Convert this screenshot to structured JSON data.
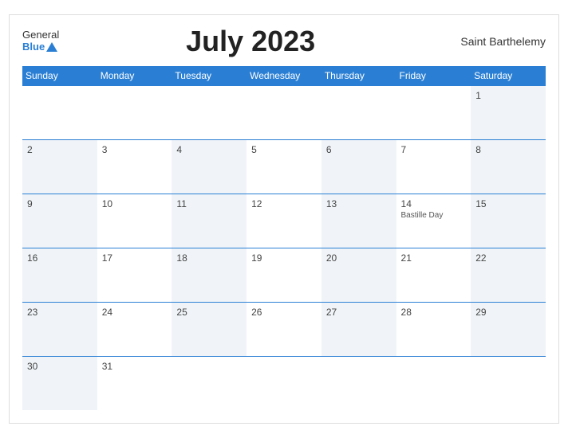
{
  "header": {
    "logo_general": "General",
    "logo_blue": "Blue",
    "title": "July 2023",
    "country": "Saint Barthelemy"
  },
  "weekdays": [
    "Sunday",
    "Monday",
    "Tuesday",
    "Wednesday",
    "Thursday",
    "Friday",
    "Saturday"
  ],
  "weeks": [
    [
      {
        "day": "",
        "holiday": ""
      },
      {
        "day": "",
        "holiday": ""
      },
      {
        "day": "",
        "holiday": ""
      },
      {
        "day": "",
        "holiday": ""
      },
      {
        "day": "",
        "holiday": ""
      },
      {
        "day": "",
        "holiday": ""
      },
      {
        "day": "1",
        "holiday": ""
      }
    ],
    [
      {
        "day": "2",
        "holiday": ""
      },
      {
        "day": "3",
        "holiday": ""
      },
      {
        "day": "4",
        "holiday": ""
      },
      {
        "day": "5",
        "holiday": ""
      },
      {
        "day": "6",
        "holiday": ""
      },
      {
        "day": "7",
        "holiday": ""
      },
      {
        "day": "8",
        "holiday": ""
      }
    ],
    [
      {
        "day": "9",
        "holiday": ""
      },
      {
        "day": "10",
        "holiday": ""
      },
      {
        "day": "11",
        "holiday": ""
      },
      {
        "day": "12",
        "holiday": ""
      },
      {
        "day": "13",
        "holiday": ""
      },
      {
        "day": "14",
        "holiday": "Bastille Day"
      },
      {
        "day": "15",
        "holiday": ""
      }
    ],
    [
      {
        "day": "16",
        "holiday": ""
      },
      {
        "day": "17",
        "holiday": ""
      },
      {
        "day": "18",
        "holiday": ""
      },
      {
        "day": "19",
        "holiday": ""
      },
      {
        "day": "20",
        "holiday": ""
      },
      {
        "day": "21",
        "holiday": ""
      },
      {
        "day": "22",
        "holiday": ""
      }
    ],
    [
      {
        "day": "23",
        "holiday": ""
      },
      {
        "day": "24",
        "holiday": ""
      },
      {
        "day": "25",
        "holiday": ""
      },
      {
        "day": "26",
        "holiday": ""
      },
      {
        "day": "27",
        "holiday": ""
      },
      {
        "day": "28",
        "holiday": ""
      },
      {
        "day": "29",
        "holiday": ""
      }
    ],
    [
      {
        "day": "30",
        "holiday": ""
      },
      {
        "day": "31",
        "holiday": ""
      },
      {
        "day": "",
        "holiday": ""
      },
      {
        "day": "",
        "holiday": ""
      },
      {
        "day": "",
        "holiday": ""
      },
      {
        "day": "",
        "holiday": ""
      },
      {
        "day": "",
        "holiday": ""
      }
    ]
  ]
}
